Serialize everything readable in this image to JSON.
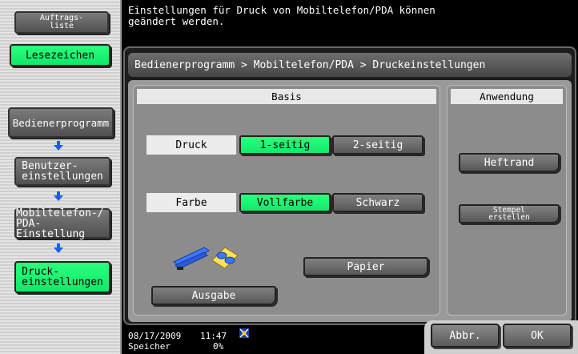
{
  "left_panel": {
    "auftragsliste_label": "Auftrags-\nliste",
    "lesezeichen_label": "Lesezeichen",
    "nav": [
      {
        "label": "Bedienerprogramm"
      },
      {
        "label": "Benutzer-\neinstellungen"
      },
      {
        "label": "Mobiltelefon-/\nPDA-Einstellung"
      },
      {
        "label": "Druck-\neinstellungen"
      }
    ]
  },
  "message": "Einstellungen für Druck von Mobiltelefon/PDA können\ngeändert werden.",
  "breadcrumb": "Bedienerprogramm > Mobiltelefon/PDA > Druckeinstellungen",
  "basis": {
    "header": "Basis",
    "druck_label": "Druck",
    "druck_options": [
      "1-seitig",
      "2-seitig"
    ],
    "farbe_label": "Farbe",
    "farbe_options": [
      "Vollfarbe",
      "Schwarz"
    ],
    "papier_label": "Papier",
    "ausgabe_label": "Ausgabe"
  },
  "anwendung": {
    "header": "Anwendung",
    "heftrand_label": "Heftrand",
    "stempel_label": "Stempel\nerstellen"
  },
  "status": {
    "date": "08/17/2009",
    "time": "11:47",
    "speicher_label": "Speicher",
    "speicher_value": "0%"
  },
  "footer": {
    "abbr_label": "Abbr.",
    "ok_label": "OK"
  },
  "colors": {
    "selected_green": "#1ef574",
    "button_gray": "#646464",
    "arrow_blue": "#1a5cff"
  },
  "icons": [
    "arrow-down-icon",
    "stapler-icon",
    "hole-punch-icon",
    "network-icon"
  ]
}
